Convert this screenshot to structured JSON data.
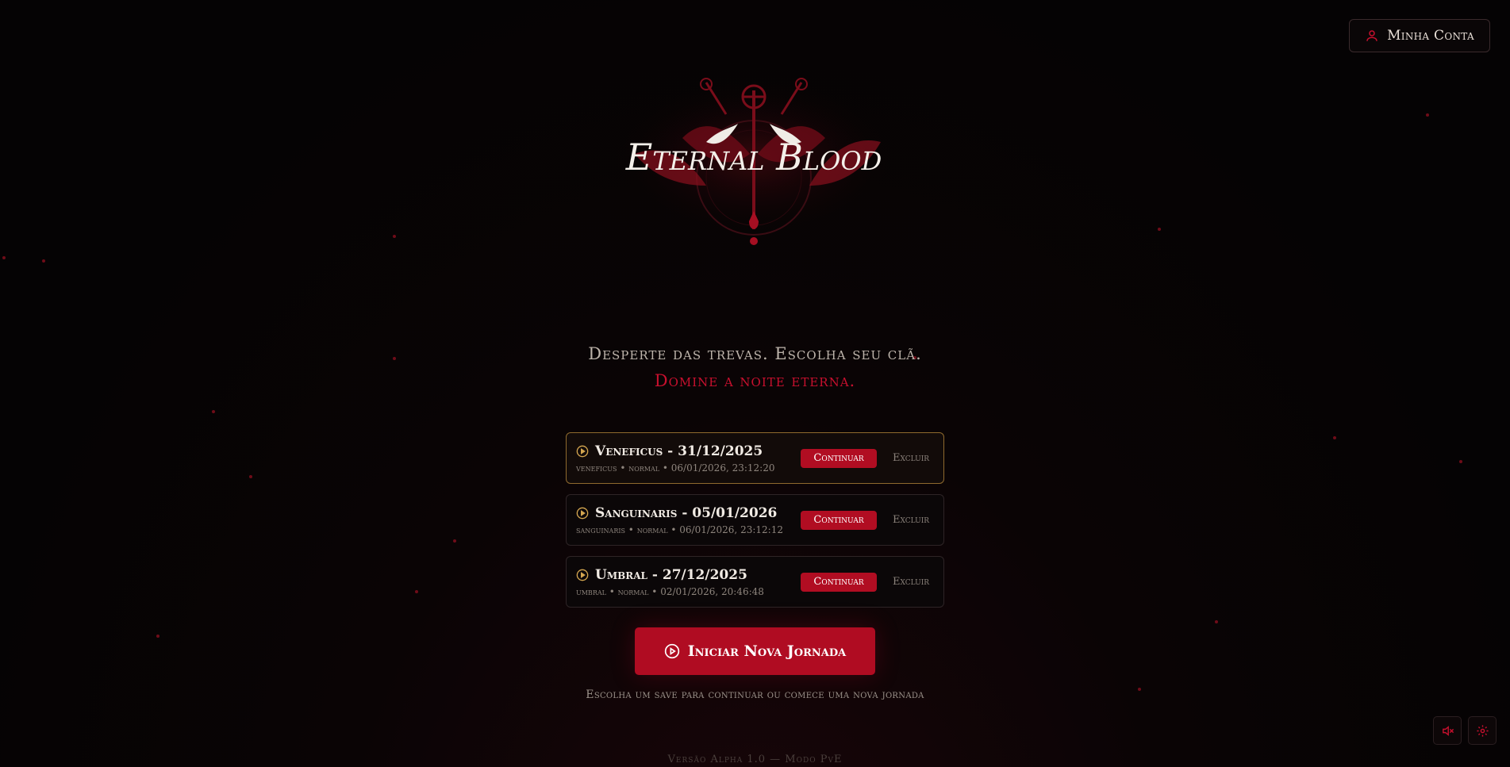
{
  "header": {
    "account_label": "Minha Conta"
  },
  "logo": {
    "text": "Eternal Blood"
  },
  "tagline": {
    "line1": "Desperte das trevas. Escolha seu clã.",
    "line2": "Domine a noite eterna."
  },
  "saves": [
    {
      "title": "Veneficus - 31/12/2025",
      "meta": "veneficus • normal • 06/01/2026, 23:12:20",
      "continue": "Continuar",
      "delete": "Excluir",
      "selected": true
    },
    {
      "title": "Sanguinaris - 05/01/2026",
      "meta": "sanguinaris • normal • 06/01/2026, 23:12:12",
      "continue": "Continuar",
      "delete": "Excluir",
      "selected": false
    },
    {
      "title": "Umbral - 27/12/2025",
      "meta": "umbral • normal • 02/01/2026, 20:46:48",
      "continue": "Continuar",
      "delete": "Excluir",
      "selected": false
    }
  ],
  "new_journey_label": "Iniciar Nova Jornada",
  "hint": "Escolha um save para continuar ou comece uma nova jornada",
  "version": "Versão Alpha 1.0 — Modo PvE",
  "colors": {
    "accent": "#b00c22",
    "gold": "#d4a650",
    "background": "#050304"
  },
  "icons": {
    "account": "user-icon",
    "play": "play-circle-icon",
    "mute": "volume-mute-icon",
    "settings": "gear-icon"
  }
}
